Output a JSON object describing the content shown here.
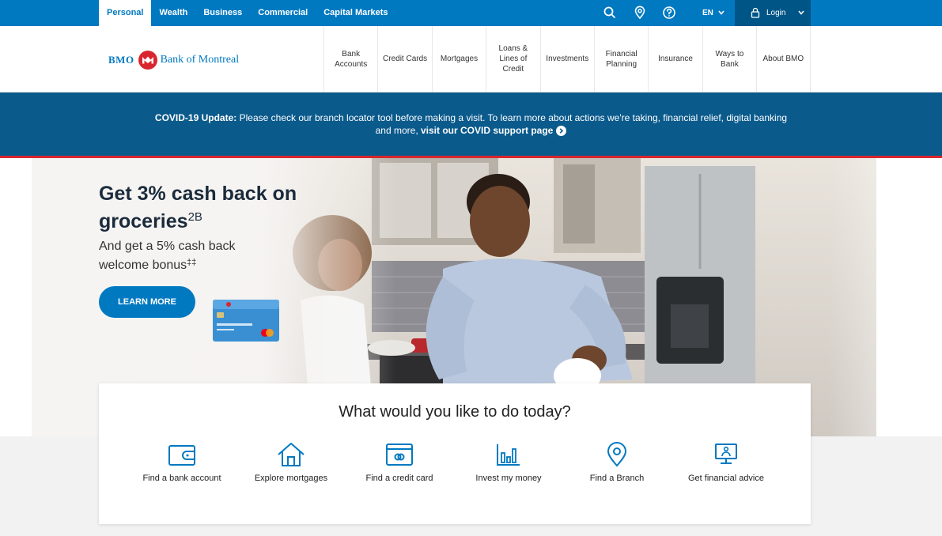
{
  "topbar": {
    "segments": [
      {
        "label": "Personal",
        "active": true
      },
      {
        "label": "Wealth",
        "active": false
      },
      {
        "label": "Business",
        "active": false
      },
      {
        "label": "Commercial",
        "active": false
      },
      {
        "label": "Capital Markets",
        "active": false
      }
    ],
    "icons": [
      "search-icon",
      "location-pin-icon",
      "help-icon"
    ],
    "language": "EN",
    "login_label": "Login",
    "color": "#0079c1"
  },
  "logo": {
    "short": "BMO",
    "name": "Bank of Montreal",
    "color": "#0079c1",
    "roundel_color": "#d9262e"
  },
  "nav": {
    "items": [
      "Bank Accounts",
      "Credit Cards",
      "Mortgages",
      "Loans & Lines of Credit",
      "Investments",
      "Financial Planning",
      "Insurance",
      "Ways to Bank",
      "About BMO"
    ]
  },
  "covid": {
    "lead": "COVID-19 Update:",
    "text": " Please check our branch locator tool before making a visit. To learn more about actions we're taking, financial relief, digital banking and more,",
    "link": "visit our COVID support page",
    "bg": "#0a5a8c"
  },
  "hero": {
    "title": "Get 3% cash back on groceries",
    "title_sup": "2B",
    "subtitle": "And get a 5% cash back welcome bonus",
    "subtitle_sup": "‡‡",
    "cta": "LEARN MORE"
  },
  "actions": {
    "heading": "What would you like to do today?",
    "items": [
      {
        "label": "Find a bank account",
        "icon": "wallet-icon"
      },
      {
        "label": "Explore mortgages",
        "icon": "house-icon"
      },
      {
        "label": "Find a credit card",
        "icon": "credit-card-icon"
      },
      {
        "label": "Invest my money",
        "icon": "bar-chart-icon"
      },
      {
        "label": "Find a Branch",
        "icon": "location-pin-icon"
      },
      {
        "label": "Get financial advice",
        "icon": "computer-advice-icon"
      }
    ]
  }
}
